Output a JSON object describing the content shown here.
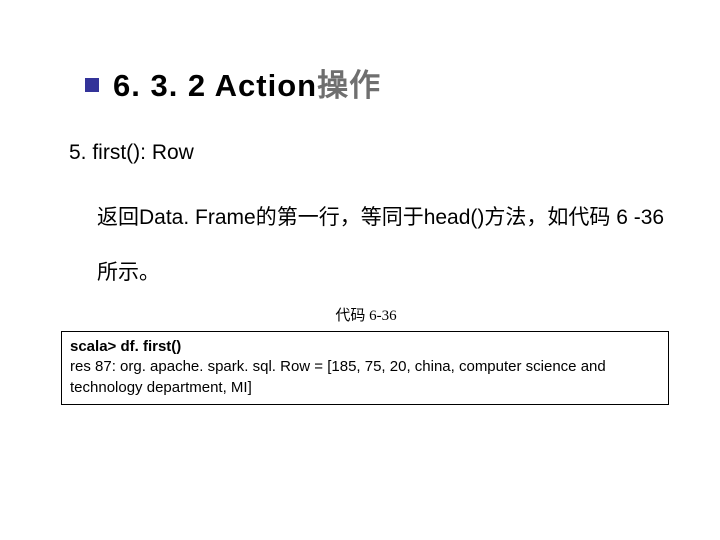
{
  "title_number": "6. 3. 2 Action",
  "title_cn": "操作",
  "sub": "5. first(): Row",
  "desc": "返回Data. Frame的第一行，等同于head()方法，如代码 6 -36所示。",
  "caption": "代码 6-36",
  "code_cmd": "scala> df. first()",
  "code_out": "res 87: org. apache. spark. sql. Row = [185, 75, 20, china, computer science and technology department, MI]"
}
